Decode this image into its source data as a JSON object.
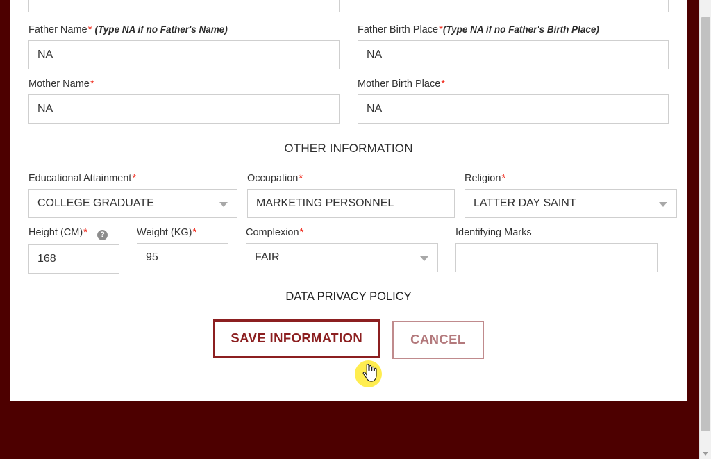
{
  "theme": {
    "page_background": "#4d0000",
    "card_background": "#ffffff",
    "required_marker_color": "#f02b1d",
    "save_accent": "#8c1f20",
    "cancel_accent": "#c08b8d",
    "cursor_highlight": "#ffec40"
  },
  "parents_section": {
    "fields": [
      {
        "name": "father-name",
        "label": "Father Name",
        "required": true,
        "hint": "(Type NA if no Father's Name)",
        "value": "NA",
        "type": "text"
      },
      {
        "name": "father-birth-place",
        "label": "Father Birth Place",
        "required": true,
        "hint": "(Type NA if no Father's Birth Place)",
        "value": "NA",
        "type": "text"
      },
      {
        "name": "mother-name",
        "label": "Mother Name",
        "required": true,
        "hint": "",
        "value": "NA",
        "type": "text"
      },
      {
        "name": "mother-birth-place",
        "label": "Mother Birth Place",
        "required": true,
        "hint": "",
        "value": "NA",
        "type": "text"
      }
    ]
  },
  "section_divider": {
    "title": "OTHER INFORMATION"
  },
  "other_information": {
    "educational_attainment": {
      "label": "Educational Attainment",
      "required": true,
      "value": "COLLEGE GRADUATE",
      "type": "select"
    },
    "occupation": {
      "label": "Occupation",
      "required": true,
      "value": "MARKETING PERSONNEL",
      "type": "text"
    },
    "religion": {
      "label": "Religion",
      "required": true,
      "value": "LATTER DAY SAINT",
      "type": "select"
    },
    "height": {
      "label": "Height (CM)",
      "required": true,
      "value": "168",
      "type": "text",
      "help_icon": "question-mark-icon",
      "help_glyph": "?"
    },
    "weight": {
      "label": "Weight (KG)",
      "required": true,
      "value": "95",
      "type": "text"
    },
    "complexion": {
      "label": "Complexion",
      "required": true,
      "value": "FAIR",
      "type": "select"
    },
    "identifying_marks": {
      "label": "Identifying Marks",
      "required": false,
      "value": "",
      "placeholder": "",
      "type": "text"
    }
  },
  "privacy": {
    "link_label": "DATA PRIVACY POLICY"
  },
  "actions": {
    "save_label": "SAVE INFORMATION",
    "cancel_label": "CANCEL"
  },
  "markers": {
    "asterisk": "*"
  }
}
